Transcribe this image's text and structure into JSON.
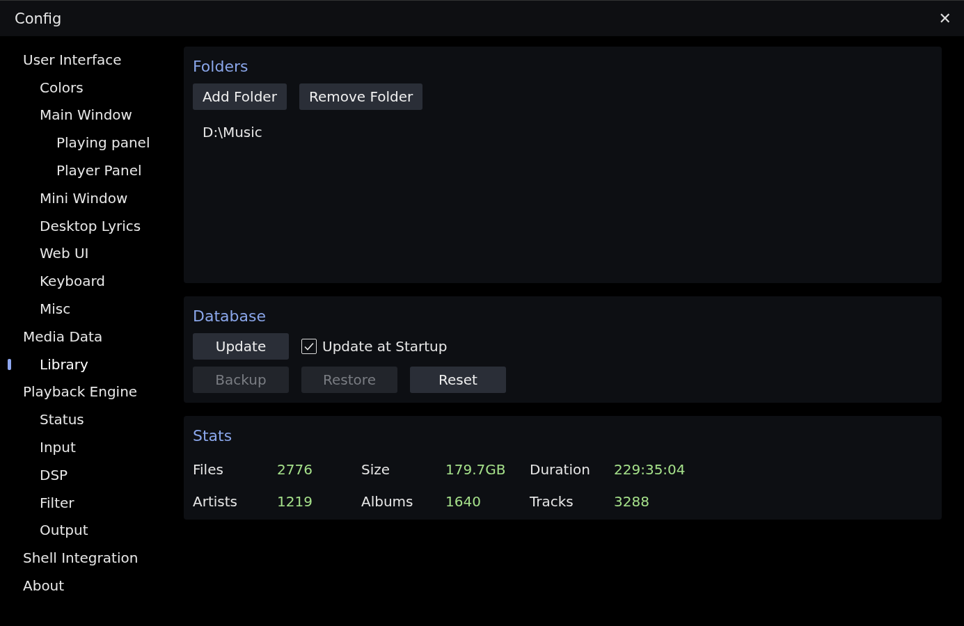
{
  "window": {
    "title": "Config",
    "close": "✕"
  },
  "sidebar": {
    "items": [
      {
        "label": "User Interface",
        "selected": false,
        "children": [
          {
            "label": "Colors",
            "selected": false
          },
          {
            "label": "Main Window",
            "selected": false,
            "children": [
              {
                "label": "Playing panel",
                "selected": false
              },
              {
                "label": "Player Panel",
                "selected": false
              }
            ]
          },
          {
            "label": "Mini Window",
            "selected": false
          },
          {
            "label": "Desktop Lyrics",
            "selected": false
          },
          {
            "label": "Web UI",
            "selected": false
          },
          {
            "label": "Keyboard",
            "selected": false
          },
          {
            "label": "Misc",
            "selected": false
          }
        ]
      },
      {
        "label": "Media Data",
        "selected": false,
        "children": [
          {
            "label": "Library",
            "selected": true
          }
        ]
      },
      {
        "label": "Playback Engine",
        "selected": false,
        "children": [
          {
            "label": "Status",
            "selected": false
          },
          {
            "label": "Input",
            "selected": false
          },
          {
            "label": "DSP",
            "selected": false
          },
          {
            "label": "Filter",
            "selected": false
          },
          {
            "label": "Output",
            "selected": false
          }
        ]
      },
      {
        "label": "Shell Integration",
        "selected": false
      },
      {
        "label": "About",
        "selected": false
      }
    ]
  },
  "folders": {
    "title": "Folders",
    "buttons": [
      {
        "label": "Add Folder",
        "disabled": false
      },
      {
        "label": "Remove Folder",
        "disabled": false
      }
    ],
    "list": [
      "D:\\Music"
    ]
  },
  "database": {
    "title": "Database",
    "update_button": {
      "label": "Update",
      "disabled": false
    },
    "update_at_startup": {
      "label": "Update at Startup",
      "checked": true
    },
    "buttons": [
      {
        "label": "Backup",
        "disabled": true
      },
      {
        "label": "Restore",
        "disabled": true
      },
      {
        "label": "Reset",
        "disabled": false
      }
    ]
  },
  "stats": {
    "title": "Stats",
    "rows": [
      [
        {
          "label": "Files",
          "value": "2776"
        },
        {
          "label": "Size",
          "value": "179.7GB"
        },
        {
          "label": "Duration",
          "value": "229:35:04"
        }
      ],
      [
        {
          "label": "Artists",
          "value": "1219"
        },
        {
          "label": "Albums",
          "value": "1640"
        },
        {
          "label": "Tracks",
          "value": "3288"
        }
      ]
    ]
  }
}
